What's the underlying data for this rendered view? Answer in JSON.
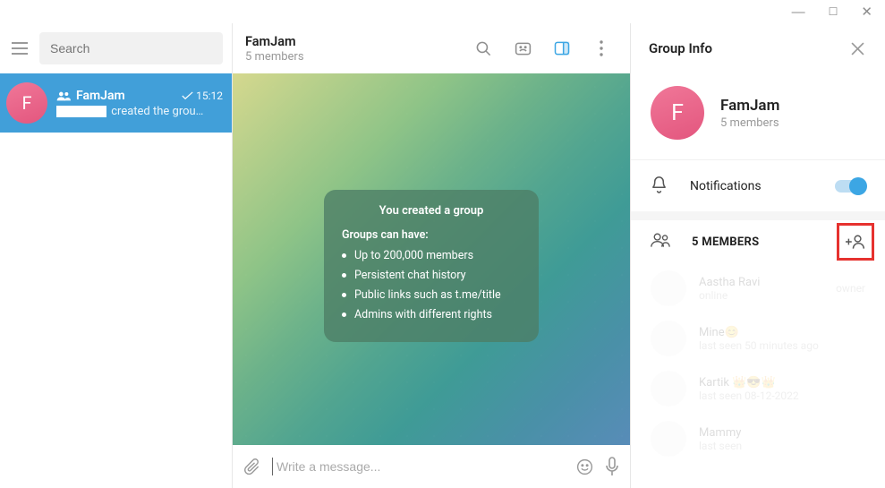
{
  "left": {
    "search_placeholder": "Search",
    "chat": {
      "avatar_letter": "F",
      "name": "FamJam",
      "time": "15:12",
      "preview_suffix": "created the grou…"
    }
  },
  "mid": {
    "title": "FamJam",
    "subtitle": "5 members",
    "card": {
      "title": "You created a group",
      "subtitle": "Groups can have:",
      "bullets": [
        "Up to 200,000 members",
        "Persistent chat history",
        "Public links such as t.me/title",
        "Admins with different rights"
      ]
    },
    "compose_placeholder": "Write a message..."
  },
  "right": {
    "header": "Group Info",
    "avatar_letter": "F",
    "name": "FamJam",
    "subtitle": "5 members",
    "notifications": "Notifications",
    "members_header": "5 MEMBERS",
    "members": [
      {
        "name": "Aastha Ravi",
        "status": "online",
        "tag": "owner"
      },
      {
        "name": "Mine😊",
        "status": "last seen 50 minutes ago",
        "tag": ""
      },
      {
        "name": "Kartik 👑😎👑",
        "status": "last seen 08-12-2022",
        "tag": ""
      },
      {
        "name": "Mammy",
        "status": "last seen",
        "tag": ""
      }
    ]
  }
}
